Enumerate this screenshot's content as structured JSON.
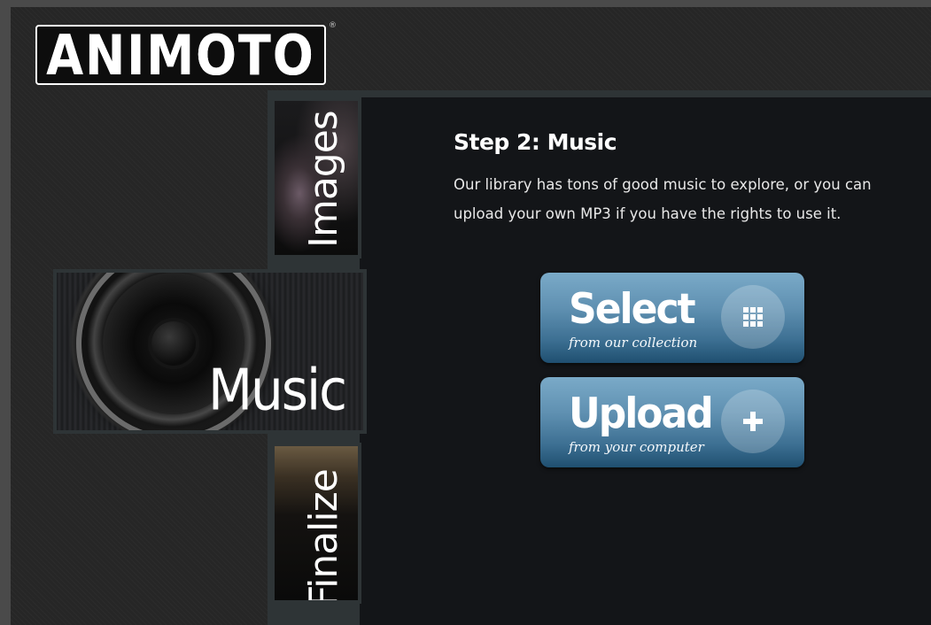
{
  "brand": {
    "logo_text": "ANIMOTO",
    "registered_mark": "®"
  },
  "steps_nav": [
    {
      "label": "Images",
      "state": "inactive"
    },
    {
      "label": "Music",
      "state": "active"
    },
    {
      "label": "Finalize",
      "state": "inactive"
    }
  ],
  "main": {
    "title": "Step 2: Music",
    "description": "Our library has tons of good music to explore, or you can upload your own MP3 if you have the rights to use it."
  },
  "actions": {
    "select": {
      "title": "Select",
      "subtitle": "from our collection",
      "icon": "grid-icon"
    },
    "upload": {
      "title": "Upload",
      "subtitle": "from your computer",
      "icon": "plus-icon"
    }
  },
  "colors": {
    "button_top": "#7aaac8",
    "button_bottom": "#1f4f70",
    "background": "#262626",
    "panel": "#131518"
  }
}
